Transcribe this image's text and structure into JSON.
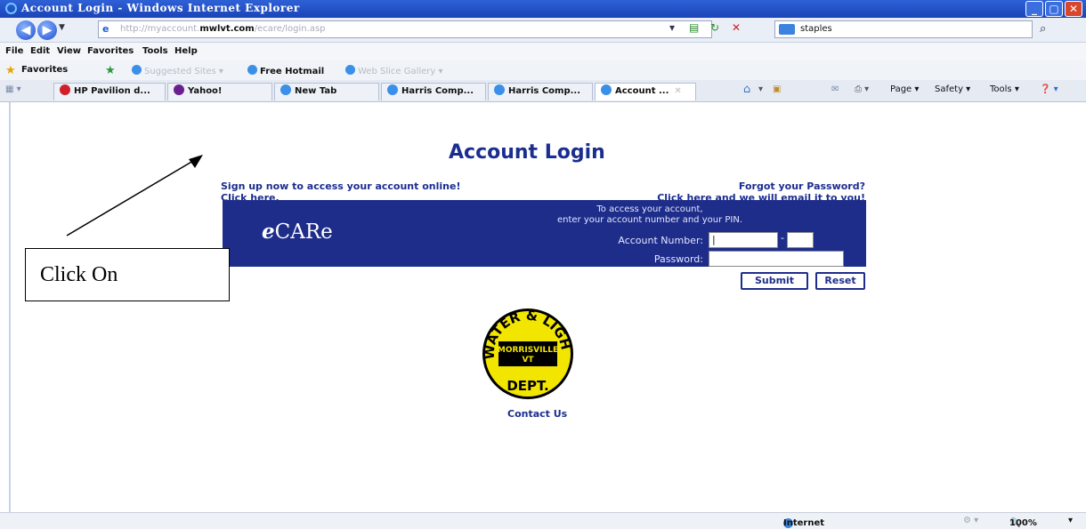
{
  "window": {
    "title": "Account Login - Windows Internet Explorer",
    "min": "_",
    "max": "▢",
    "close": "✕"
  },
  "address": {
    "url_prefix": "http://myaccount.",
    "url_domain": "mwlvt.com",
    "url_path": "/ecare/login.asp",
    "search_value": "staples"
  },
  "menu": [
    "File",
    "Edit",
    "View",
    "Favorites",
    "Tools",
    "Help"
  ],
  "favorites_bar": {
    "favorites_label": "Favorites",
    "suggested_sites": "Suggested Sites ▾",
    "free_hotmail": "Free Hotmail",
    "web_slice_gallery": "Web Slice Gallery ▾"
  },
  "tabs": [
    {
      "label": "HP Pavilion d...",
      "icon_color": "#d0202a"
    },
    {
      "label": "Yahoo!",
      "icon_color": "#6a1f8f"
    },
    {
      "label": "New Tab",
      "icon_color": "#3a8fe8"
    },
    {
      "label": "Harris Comp...",
      "icon_color": "#3a8fe8"
    },
    {
      "label": "Harris Comp...",
      "icon_color": "#3a8fe8"
    },
    {
      "label": "Account ...",
      "icon_color": "#3a8fe8"
    }
  ],
  "command_bar": {
    "page": "Page ▾",
    "safety": "Safety ▾",
    "tools": "Tools ▾"
  },
  "page": {
    "title": "Account Login",
    "signup_line1": "Sign up now to access your account online!",
    "signup_line2": "Click here.",
    "forgot_line1": "Forgot your Password?",
    "forgot_line2": "Click here and we will email it to you!",
    "intro_line1": "To access your account,",
    "intro_line2": "enter your account number and your PIN.",
    "brand_e": "e",
    "brand_rest": "CARe",
    "account_label": "Account Number:",
    "password_label": "Password:",
    "submit": "Submit",
    "reset": "Reset",
    "contact": "Contact Us",
    "logo": {
      "top": "WATER & LIGHT",
      "center_line1": "MORRISVILLE",
      "center_line2": "VT",
      "bottom": "DEPT."
    }
  },
  "annotation": {
    "text": "Click On"
  },
  "status": {
    "zone": "Internet",
    "zoom": "100%"
  },
  "colors": {
    "brand_blue": "#1e2d8a",
    "link_blue": "#1b2d8f",
    "logo_yellow": "#f2e600"
  }
}
